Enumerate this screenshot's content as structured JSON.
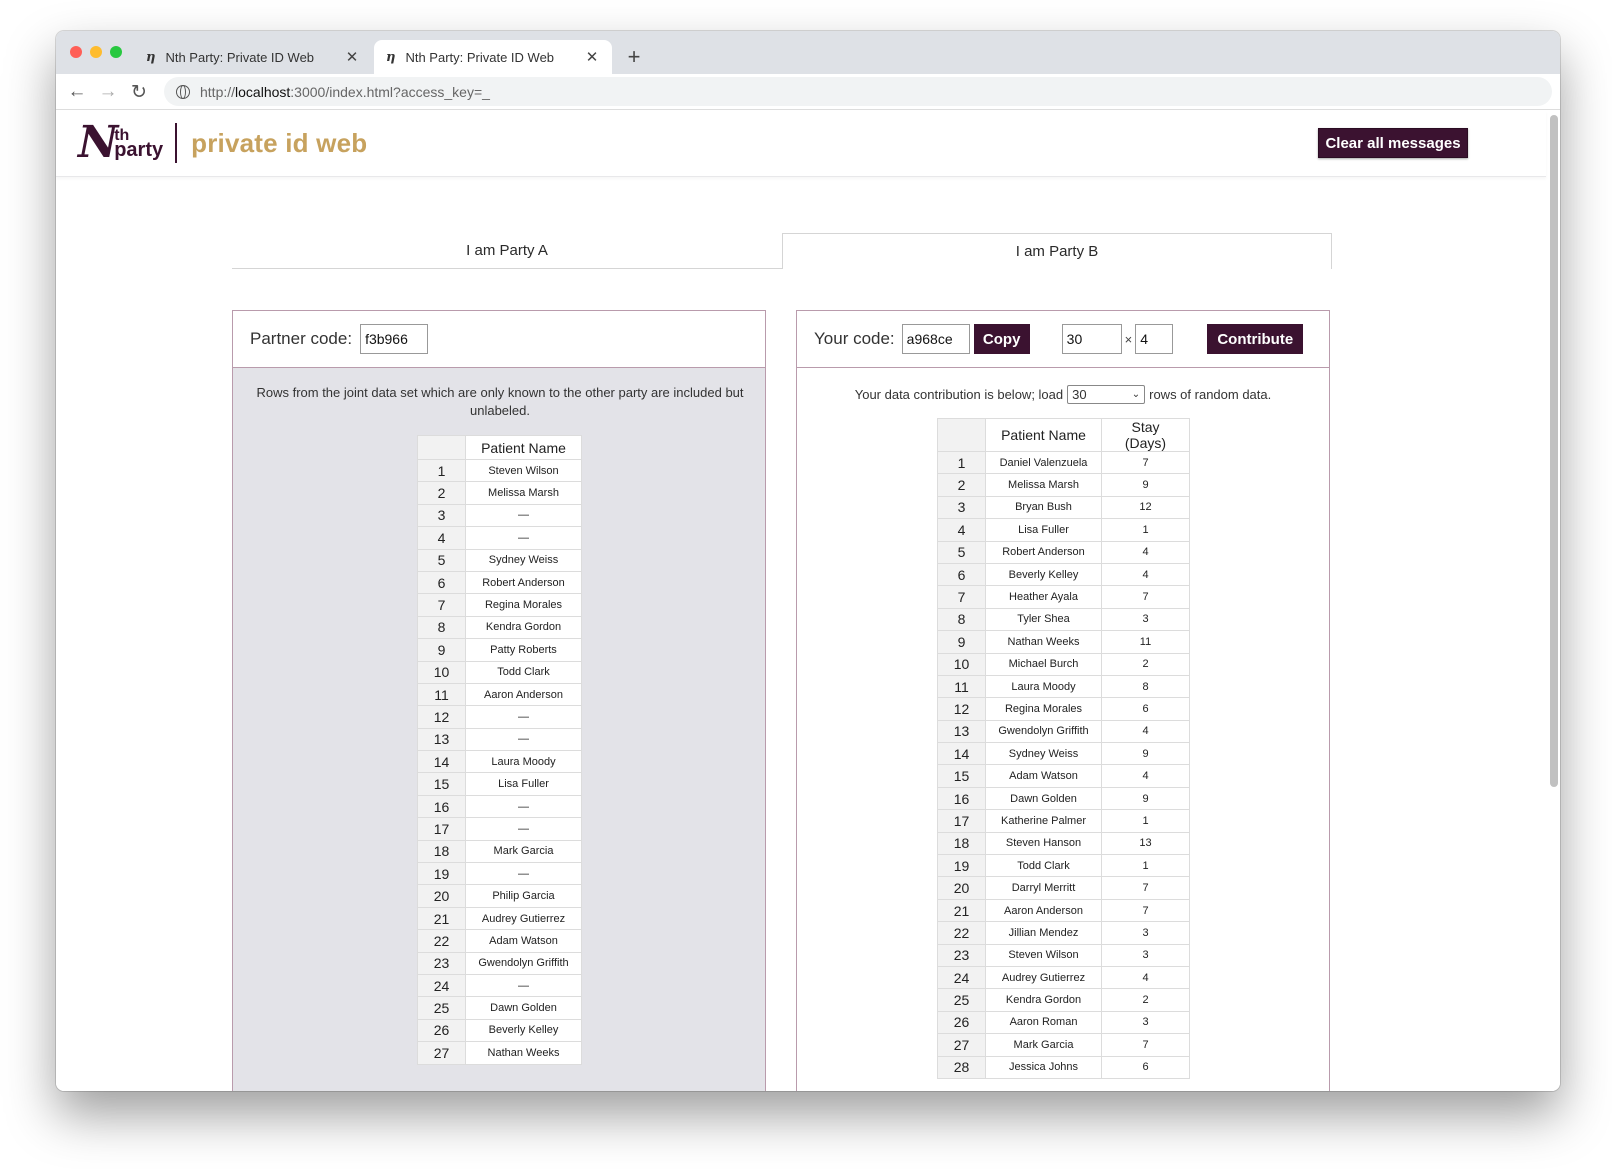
{
  "browser": {
    "tabs": [
      {
        "title": "Nth Party: Private ID Web",
        "favicon": "nth-party-favicon",
        "active": false
      },
      {
        "title": "Nth Party: Private ID Web",
        "favicon": "nth-party-favicon",
        "active": true
      }
    ],
    "new_tab": "+",
    "url_prefix": "http://",
    "url_host": "localhost",
    "url_rest": ":3000/index.html?access_key=_",
    "colors": {
      "close": "#ff5f57",
      "minimize": "#febc2e",
      "zoom": "#28c840"
    }
  },
  "header": {
    "logo_letter": "N",
    "logo_sup": "th",
    "logo_word": "party",
    "app_name": "private id web",
    "clear_button": "Clear all messages",
    "brand_color": "#3b1230",
    "accent_color": "#c7a25e"
  },
  "party_tabs": [
    {
      "label": "I am Party A",
      "active": false
    },
    {
      "label": "I am Party B",
      "active": true
    }
  ],
  "party_a": {
    "partner_code_label": "Partner code:",
    "partner_code_value": "f3b966",
    "note": "Rows from the joint data set which are only known to the other party are included but unlabeled.",
    "table_header": "Patient Name",
    "rows": [
      {
        "idx": "1",
        "name": "Steven Wilson"
      },
      {
        "idx": "2",
        "name": "Melissa Marsh"
      },
      {
        "idx": "3",
        "name": "—"
      },
      {
        "idx": "4",
        "name": "—"
      },
      {
        "idx": "5",
        "name": "Sydney Weiss"
      },
      {
        "idx": "6",
        "name": "Robert Anderson"
      },
      {
        "idx": "7",
        "name": "Regina Morales"
      },
      {
        "idx": "8",
        "name": "Kendra Gordon"
      },
      {
        "idx": "9",
        "name": "Patty Roberts"
      },
      {
        "idx": "10",
        "name": "Todd Clark"
      },
      {
        "idx": "11",
        "name": "Aaron Anderson"
      },
      {
        "idx": "12",
        "name": "—"
      },
      {
        "idx": "13",
        "name": "—"
      },
      {
        "idx": "14",
        "name": "Laura Moody"
      },
      {
        "idx": "15",
        "name": "Lisa Fuller"
      },
      {
        "idx": "16",
        "name": "—"
      },
      {
        "idx": "17",
        "name": "—"
      },
      {
        "idx": "18",
        "name": "Mark Garcia"
      },
      {
        "idx": "19",
        "name": "—"
      },
      {
        "idx": "20",
        "name": "Philip Garcia"
      },
      {
        "idx": "21",
        "name": "Audrey Gutierrez"
      },
      {
        "idx": "22",
        "name": "Adam Watson"
      },
      {
        "idx": "23",
        "name": "Gwendolyn Griffith"
      },
      {
        "idx": "24",
        "name": "—"
      },
      {
        "idx": "25",
        "name": "Dawn Golden"
      },
      {
        "idx": "26",
        "name": "Beverly Kelley"
      },
      {
        "idx": "27",
        "name": "Nathan Weeks"
      }
    ]
  },
  "party_b": {
    "your_code_label": "Your code:",
    "your_code_value": "a968ce",
    "copy_button": "Copy",
    "rows_input": "30",
    "times": "×",
    "cols_input": "4",
    "contribute_button": "Contribute",
    "note_before": "Your data contribution is below; load",
    "select_value": "30",
    "note_after": "rows of random data.",
    "table_headers": [
      "Patient Name",
      "Stay (Days)"
    ],
    "rows": [
      {
        "idx": "1",
        "name": "Daniel Valenzuela",
        "stay": "7"
      },
      {
        "idx": "2",
        "name": "Melissa Marsh",
        "stay": "9"
      },
      {
        "idx": "3",
        "name": "Bryan Bush",
        "stay": "12"
      },
      {
        "idx": "4",
        "name": "Lisa Fuller",
        "stay": "1"
      },
      {
        "idx": "5",
        "name": "Robert Anderson",
        "stay": "4"
      },
      {
        "idx": "6",
        "name": "Beverly Kelley",
        "stay": "4"
      },
      {
        "idx": "7",
        "name": "Heather Ayala",
        "stay": "7"
      },
      {
        "idx": "8",
        "name": "Tyler Shea",
        "stay": "3"
      },
      {
        "idx": "9",
        "name": "Nathan Weeks",
        "stay": "11"
      },
      {
        "idx": "10",
        "name": "Michael Burch",
        "stay": "2"
      },
      {
        "idx": "11",
        "name": "Laura Moody",
        "stay": "8"
      },
      {
        "idx": "12",
        "name": "Regina Morales",
        "stay": "6"
      },
      {
        "idx": "13",
        "name": "Gwendolyn Griffith",
        "stay": "4"
      },
      {
        "idx": "14",
        "name": "Sydney Weiss",
        "stay": "9"
      },
      {
        "idx": "15",
        "name": "Adam Watson",
        "stay": "4"
      },
      {
        "idx": "16",
        "name": "Dawn Golden",
        "stay": "9"
      },
      {
        "idx": "17",
        "name": "Katherine Palmer",
        "stay": "1"
      },
      {
        "idx": "18",
        "name": "Steven Hanson",
        "stay": "13"
      },
      {
        "idx": "19",
        "name": "Todd Clark",
        "stay": "1"
      },
      {
        "idx": "20",
        "name": "Darryl Merritt",
        "stay": "7"
      },
      {
        "idx": "21",
        "name": "Aaron Anderson",
        "stay": "7"
      },
      {
        "idx": "22",
        "name": "Jillian Mendez",
        "stay": "3"
      },
      {
        "idx": "23",
        "name": "Steven Wilson",
        "stay": "3"
      },
      {
        "idx": "24",
        "name": "Audrey Gutierrez",
        "stay": "4"
      },
      {
        "idx": "25",
        "name": "Kendra Gordon",
        "stay": "2"
      },
      {
        "idx": "26",
        "name": "Aaron Roman",
        "stay": "3"
      },
      {
        "idx": "27",
        "name": "Mark Garcia",
        "stay": "7"
      },
      {
        "idx": "28",
        "name": "Jessica Johns",
        "stay": "6"
      }
    ]
  }
}
